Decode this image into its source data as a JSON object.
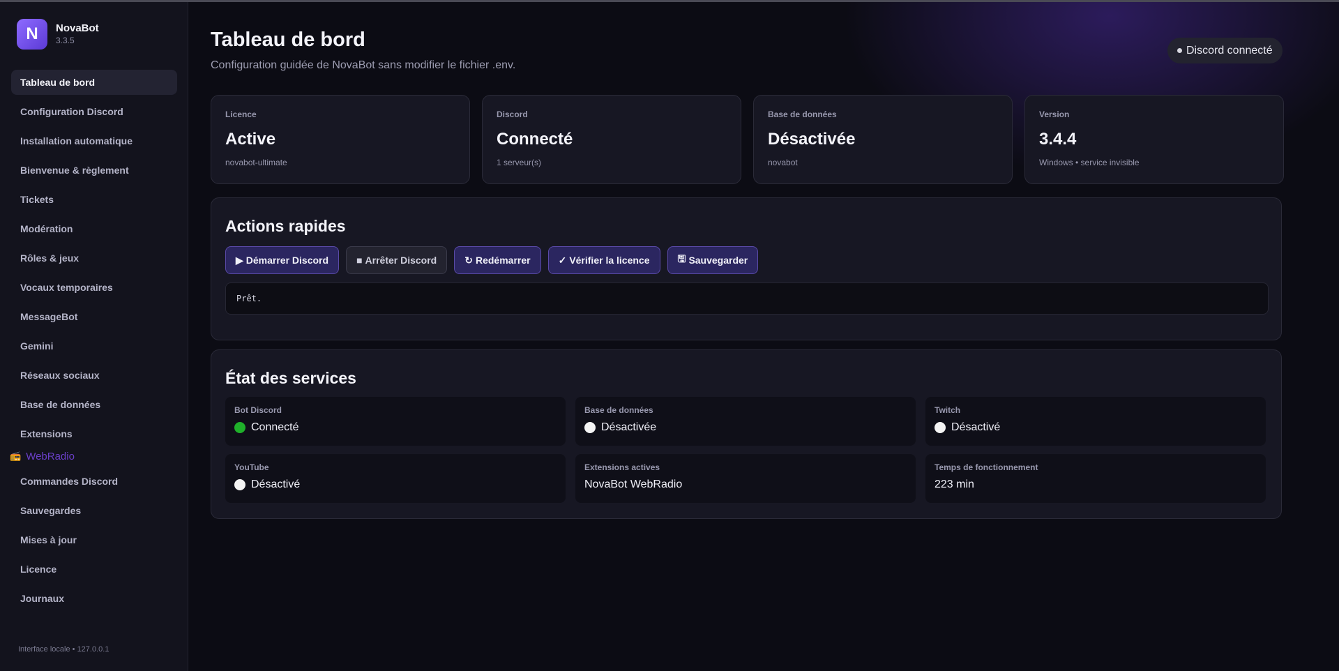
{
  "app": {
    "name": "NovaBot",
    "version": "3.3.5"
  },
  "sidebar": {
    "items": [
      {
        "label": "Tableau de bord"
      },
      {
        "label": "Configuration Discord"
      },
      {
        "label": "Installation automatique"
      },
      {
        "label": "Bienvenue & règlement"
      },
      {
        "label": "Tickets"
      },
      {
        "label": "Modération"
      },
      {
        "label": "Rôles & jeux"
      },
      {
        "label": "Vocaux temporaires"
      },
      {
        "label": "MessageBot"
      },
      {
        "label": "Gemini"
      },
      {
        "label": "Réseaux sociaux"
      },
      {
        "label": "Base de données"
      },
      {
        "label": "Extensions"
      },
      {
        "label": "WebRadio",
        "icon": "radio-icon",
        "icon_glyph": "📻"
      },
      {
        "label": "Commandes Discord"
      },
      {
        "label": "Sauvegardes"
      },
      {
        "label": "Mises à jour"
      },
      {
        "label": "Licence"
      },
      {
        "label": "Journaux"
      }
    ],
    "footer": "Interface locale • 127.0.0.1"
  },
  "header": {
    "title": "Tableau de bord",
    "subtitle": "Configuration guidée de NovaBot sans modifier le fichier .env.",
    "status_pill": "Discord connecté"
  },
  "stats": [
    {
      "label": "Licence",
      "value": "Active",
      "detail": "novabot-ultimate"
    },
    {
      "label": "Discord",
      "value": "Connecté",
      "detail": "1 serveur(s)"
    },
    {
      "label": "Base de données",
      "value": "Désactivée",
      "detail": "novabot"
    },
    {
      "label": "Version",
      "value": "3.4.4",
      "detail": "Windows • service invisible"
    }
  ],
  "actions": {
    "title": "Actions rapides",
    "buttons": [
      {
        "icon": "▶",
        "label": "Démarrer Discord"
      },
      {
        "icon": "■",
        "label": "Arrêter Discord"
      },
      {
        "icon": "↻",
        "label": "Redémarrer"
      },
      {
        "icon": "✓",
        "label": "Vérifier la licence"
      },
      {
        "icon": "🖫",
        "label": "Sauvegarder"
      }
    ],
    "console_output": "Prêt."
  },
  "services": {
    "title": "État des services",
    "items": [
      {
        "label": "Bot Discord",
        "value": "Connecté",
        "status": "on"
      },
      {
        "label": "Base de données",
        "value": "Désactivée",
        "status": "off"
      },
      {
        "label": "Twitch",
        "value": "Désactivé",
        "status": "off"
      },
      {
        "label": "YouTube",
        "value": "Désactivé",
        "status": "off"
      },
      {
        "label": "Extensions actives",
        "value": "NovaBot WebRadio"
      },
      {
        "label": "Temps de fonctionnement",
        "value": "223 min"
      }
    ]
  },
  "colors": {
    "accent": "#7b5cf0",
    "status_on": "#1fb02a",
    "status_off": "#f4f4f4"
  }
}
